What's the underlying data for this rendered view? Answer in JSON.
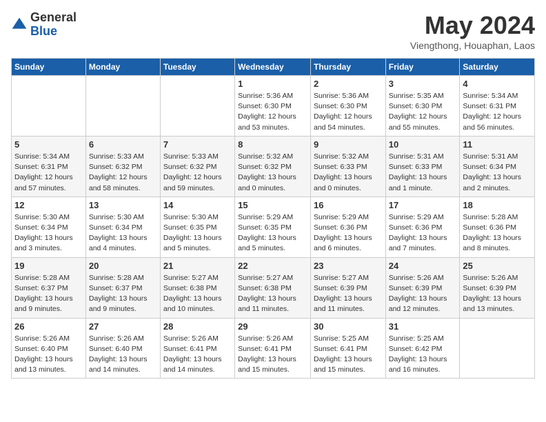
{
  "logo": {
    "general": "General",
    "blue": "Blue"
  },
  "title": "May 2024",
  "location": "Viengthong, Houaphan, Laos",
  "days_of_week": [
    "Sunday",
    "Monday",
    "Tuesday",
    "Wednesday",
    "Thursday",
    "Friday",
    "Saturday"
  ],
  "weeks": [
    [
      {
        "day": "",
        "info": ""
      },
      {
        "day": "",
        "info": ""
      },
      {
        "day": "",
        "info": ""
      },
      {
        "day": "1",
        "info": "Sunrise: 5:36 AM\nSunset: 6:30 PM\nDaylight: 12 hours\nand 53 minutes."
      },
      {
        "day": "2",
        "info": "Sunrise: 5:36 AM\nSunset: 6:30 PM\nDaylight: 12 hours\nand 54 minutes."
      },
      {
        "day": "3",
        "info": "Sunrise: 5:35 AM\nSunset: 6:30 PM\nDaylight: 12 hours\nand 55 minutes."
      },
      {
        "day": "4",
        "info": "Sunrise: 5:34 AM\nSunset: 6:31 PM\nDaylight: 12 hours\nand 56 minutes."
      }
    ],
    [
      {
        "day": "5",
        "info": "Sunrise: 5:34 AM\nSunset: 6:31 PM\nDaylight: 12 hours\nand 57 minutes."
      },
      {
        "day": "6",
        "info": "Sunrise: 5:33 AM\nSunset: 6:32 PM\nDaylight: 12 hours\nand 58 minutes."
      },
      {
        "day": "7",
        "info": "Sunrise: 5:33 AM\nSunset: 6:32 PM\nDaylight: 12 hours\nand 59 minutes."
      },
      {
        "day": "8",
        "info": "Sunrise: 5:32 AM\nSunset: 6:32 PM\nDaylight: 13 hours\nand 0 minutes."
      },
      {
        "day": "9",
        "info": "Sunrise: 5:32 AM\nSunset: 6:33 PM\nDaylight: 13 hours\nand 0 minutes."
      },
      {
        "day": "10",
        "info": "Sunrise: 5:31 AM\nSunset: 6:33 PM\nDaylight: 13 hours\nand 1 minute."
      },
      {
        "day": "11",
        "info": "Sunrise: 5:31 AM\nSunset: 6:34 PM\nDaylight: 13 hours\nand 2 minutes."
      }
    ],
    [
      {
        "day": "12",
        "info": "Sunrise: 5:30 AM\nSunset: 6:34 PM\nDaylight: 13 hours\nand 3 minutes."
      },
      {
        "day": "13",
        "info": "Sunrise: 5:30 AM\nSunset: 6:34 PM\nDaylight: 13 hours\nand 4 minutes."
      },
      {
        "day": "14",
        "info": "Sunrise: 5:30 AM\nSunset: 6:35 PM\nDaylight: 13 hours\nand 5 minutes."
      },
      {
        "day": "15",
        "info": "Sunrise: 5:29 AM\nSunset: 6:35 PM\nDaylight: 13 hours\nand 5 minutes."
      },
      {
        "day": "16",
        "info": "Sunrise: 5:29 AM\nSunset: 6:36 PM\nDaylight: 13 hours\nand 6 minutes."
      },
      {
        "day": "17",
        "info": "Sunrise: 5:29 AM\nSunset: 6:36 PM\nDaylight: 13 hours\nand 7 minutes."
      },
      {
        "day": "18",
        "info": "Sunrise: 5:28 AM\nSunset: 6:36 PM\nDaylight: 13 hours\nand 8 minutes."
      }
    ],
    [
      {
        "day": "19",
        "info": "Sunrise: 5:28 AM\nSunset: 6:37 PM\nDaylight: 13 hours\nand 9 minutes."
      },
      {
        "day": "20",
        "info": "Sunrise: 5:28 AM\nSunset: 6:37 PM\nDaylight: 13 hours\nand 9 minutes."
      },
      {
        "day": "21",
        "info": "Sunrise: 5:27 AM\nSunset: 6:38 PM\nDaylight: 13 hours\nand 10 minutes."
      },
      {
        "day": "22",
        "info": "Sunrise: 5:27 AM\nSunset: 6:38 PM\nDaylight: 13 hours\nand 11 minutes."
      },
      {
        "day": "23",
        "info": "Sunrise: 5:27 AM\nSunset: 6:39 PM\nDaylight: 13 hours\nand 11 minutes."
      },
      {
        "day": "24",
        "info": "Sunrise: 5:26 AM\nSunset: 6:39 PM\nDaylight: 13 hours\nand 12 minutes."
      },
      {
        "day": "25",
        "info": "Sunrise: 5:26 AM\nSunset: 6:39 PM\nDaylight: 13 hours\nand 13 minutes."
      }
    ],
    [
      {
        "day": "26",
        "info": "Sunrise: 5:26 AM\nSunset: 6:40 PM\nDaylight: 13 hours\nand 13 minutes."
      },
      {
        "day": "27",
        "info": "Sunrise: 5:26 AM\nSunset: 6:40 PM\nDaylight: 13 hours\nand 14 minutes."
      },
      {
        "day": "28",
        "info": "Sunrise: 5:26 AM\nSunset: 6:41 PM\nDaylight: 13 hours\nand 14 minutes."
      },
      {
        "day": "29",
        "info": "Sunrise: 5:26 AM\nSunset: 6:41 PM\nDaylight: 13 hours\nand 15 minutes."
      },
      {
        "day": "30",
        "info": "Sunrise: 5:25 AM\nSunset: 6:41 PM\nDaylight: 13 hours\nand 15 minutes."
      },
      {
        "day": "31",
        "info": "Sunrise: 5:25 AM\nSunset: 6:42 PM\nDaylight: 13 hours\nand 16 minutes."
      },
      {
        "day": "",
        "info": ""
      }
    ]
  ]
}
